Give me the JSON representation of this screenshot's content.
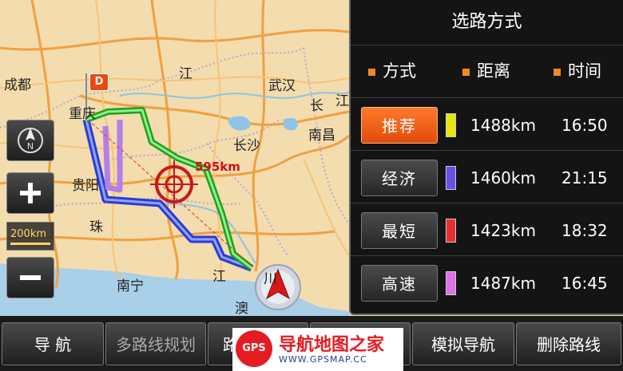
{
  "map": {
    "labels": {
      "chengdu": "成都",
      "chongqing": "重庆",
      "jiang_top": "江",
      "wuhan": "武汉",
      "chang": "长",
      "jiang_right": "江",
      "nanchang": "南昌",
      "changsha": "长沙",
      "guiyang": "贵阳",
      "zhu": "珠",
      "nanning": "南宁",
      "jiang_bottom": "江",
      "ao": "澳",
      "chuan": "川"
    },
    "distance": "595km",
    "dest_marker": "D",
    "scale": "200km"
  },
  "panel": {
    "title": "选路方式",
    "headers": {
      "mode": "方式",
      "distance": "距离",
      "time": "时间"
    },
    "rows": [
      {
        "label": "推荐",
        "distance": "1488km",
        "time": "16:50",
        "color": "#e8e800",
        "active": true
      },
      {
        "label": "经济",
        "distance": "1460km",
        "time": "21:15",
        "color": "#6b4ee6",
        "active": false
      },
      {
        "label": "最短",
        "distance": "1423km",
        "time": "18:32",
        "color": "#e83030",
        "active": false
      },
      {
        "label": "高速",
        "distance": "1487km",
        "time": "16:45",
        "color": "#e070e8",
        "active": false
      }
    ]
  },
  "toolbar": {
    "navigate": "导 航",
    "multi_route": "多路线规划",
    "route_partial": "路",
    "partial_right": "览",
    "simulate": "模拟导航",
    "delete_route": "删除路线"
  },
  "watermark": {
    "logo": "GPS",
    "name": "导航地图之家",
    "url": "WWW.GPSMAP.CC"
  }
}
